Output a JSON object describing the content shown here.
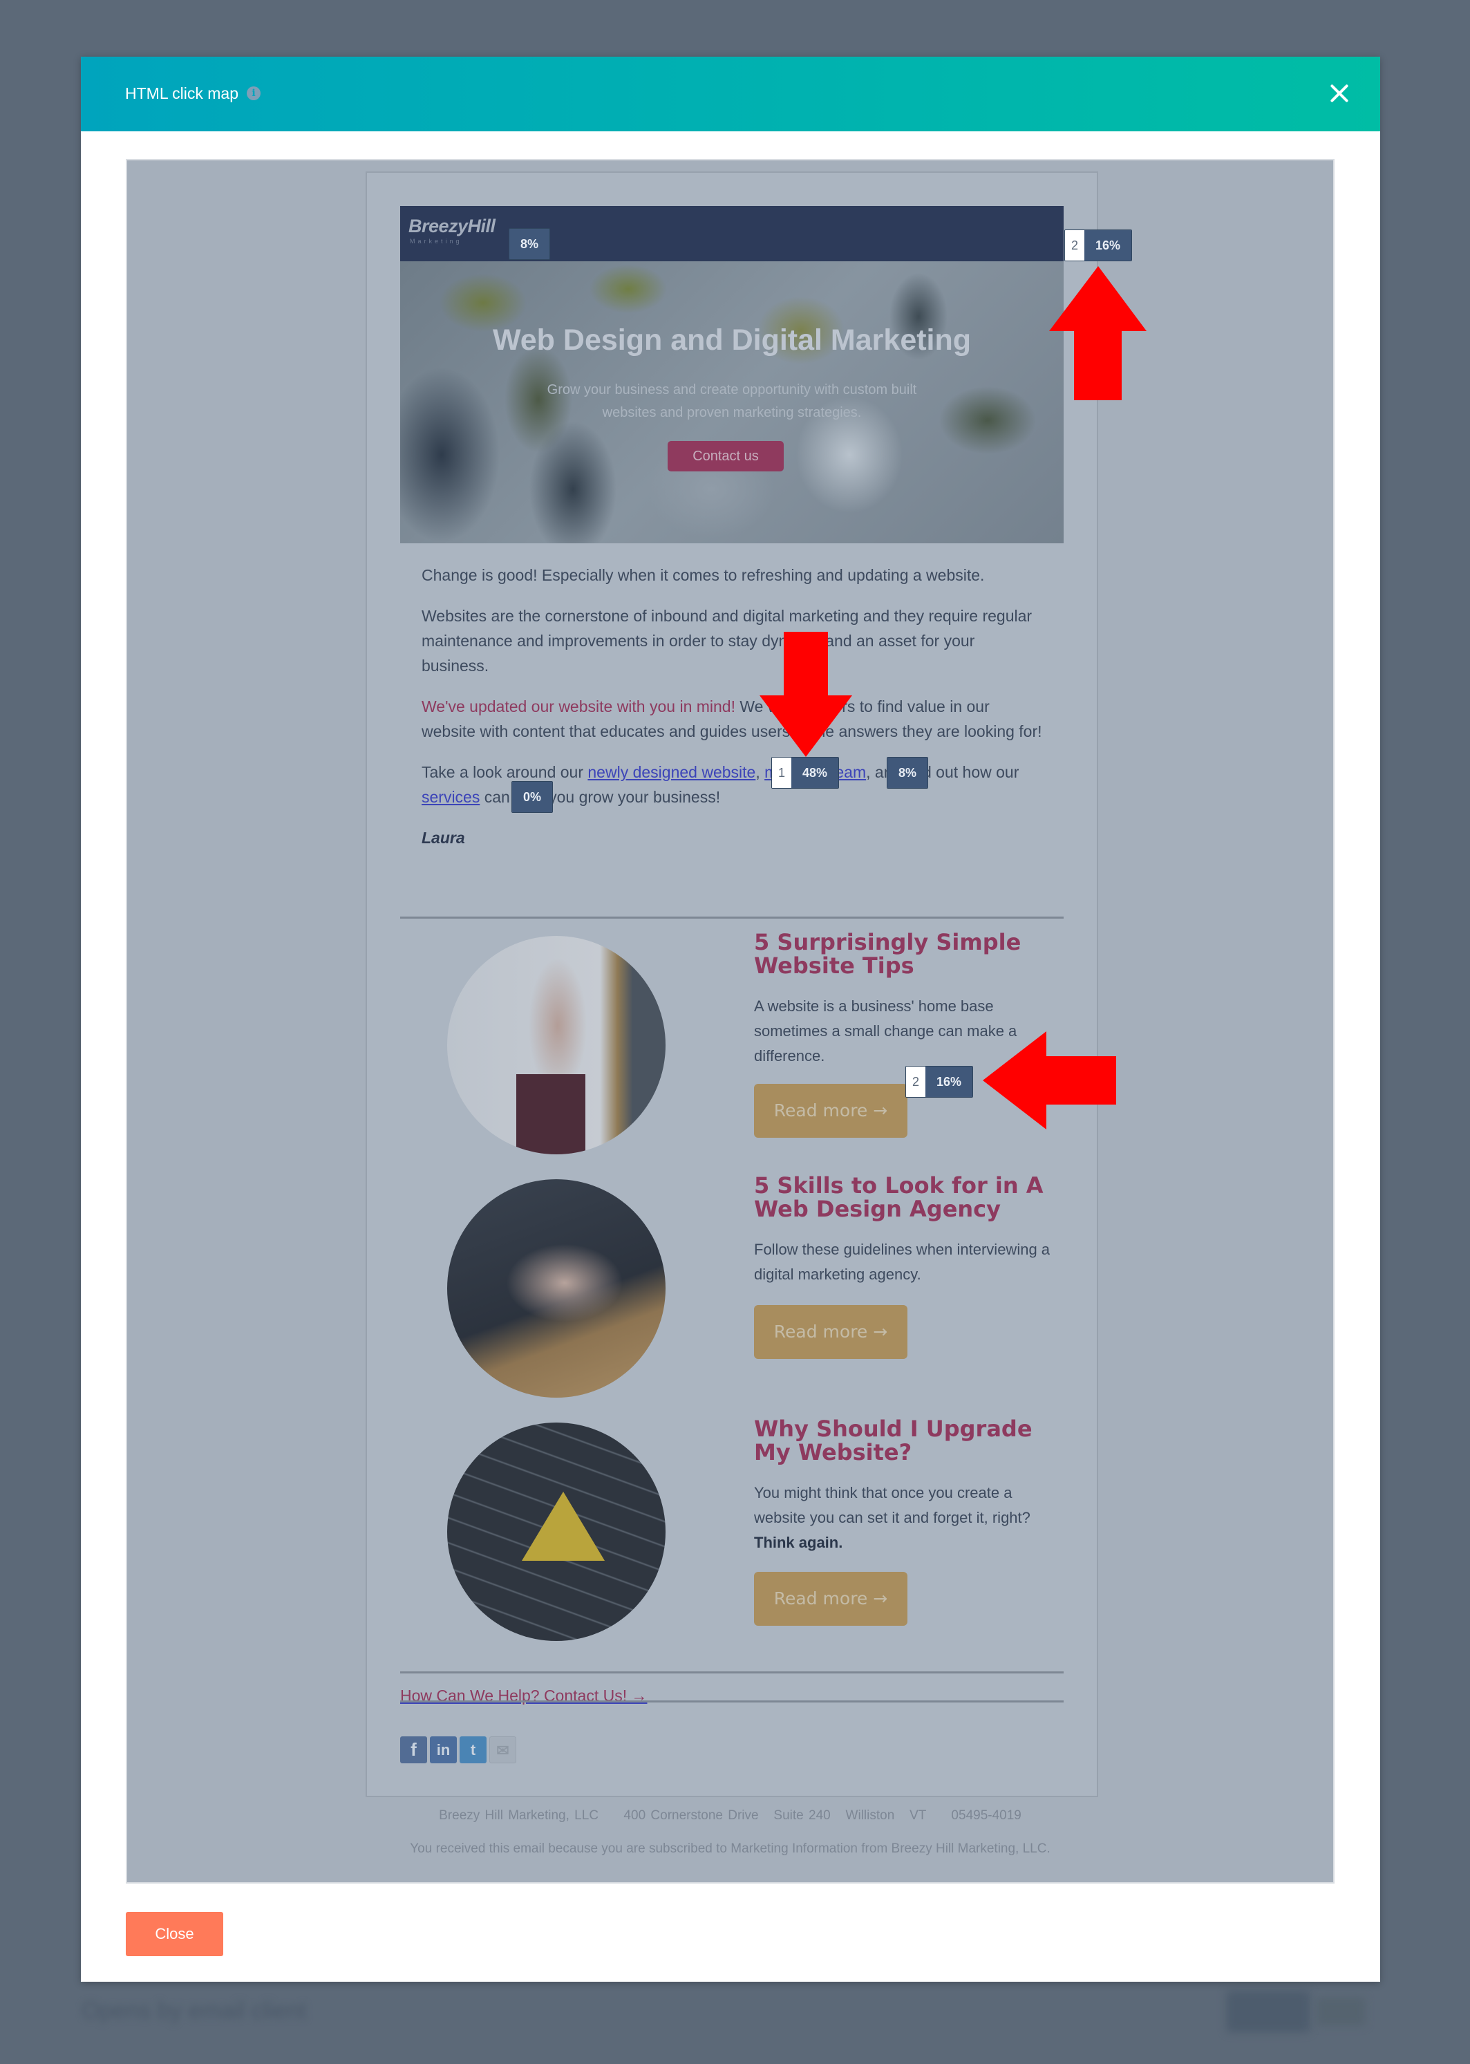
{
  "background": {
    "page_heading": "Opens by email client"
  },
  "modal": {
    "title": "HTML click map",
    "info_icon": "info-icon",
    "close_icon": "close-icon",
    "footer": {
      "close_label": "Close"
    },
    "colors": {
      "header_start": "#00a4bd",
      "header_end": "#00bda5",
      "close_button": "#ff7a59"
    }
  },
  "email": {
    "logo": {
      "name": "BreezyHill",
      "tagline": "Marketing"
    },
    "hero": {
      "title": "Web Design and Digital Marketing",
      "subtitle": "Grow your business and create opportunity with custom built websites and proven marketing strategies.",
      "button_label": "Contact us"
    },
    "body": {
      "p1": "Change is good! Especially when it comes to refreshing and updating a website.",
      "p2": "Websites are the cornerstone of inbound and digital marketing and they require regular maintenance and improvements in order to stay dynamic and an asset for your business.",
      "p3_accent": "We've updated our website with you in mind!",
      "p3_rest": " We want visitors to find value in our website with content that educates and guides users to the answers they are looking for!",
      "p4_start": "Take a look around our ",
      "p4_link1": "newly designed website",
      "p4_sep": ", ",
      "p4_link2": "meet the team",
      "p4_mid": ", and find out how our ",
      "p4_link3": "services",
      "p4_end": " can help you grow your business!",
      "signature": "Laura"
    },
    "posts": [
      {
        "title": "5 Surprisingly Simple Website Tips",
        "description": "A website is a business' home base sometimes a small change can make a difference.",
        "button_label": "Read more →",
        "image": "hand-drawing-sketch-image"
      },
      {
        "title": "5 Skills to Look for in A Web Design Agency",
        "description": "Follow these guidelines when interviewing a digital marketing agency.",
        "button_label": "Read more →",
        "image": "hands-typing-laptop-image"
      },
      {
        "title": "Why Should I Upgrade My Website?",
        "description_plain": "You might think that once you create a website you can set it and forget it, right? ",
        "description_bold": "Think again.",
        "button_label": "Read more →",
        "image": "keyboard-under-construction-image"
      }
    ],
    "cta_link": "How Can We Help? Contact Us! →",
    "social": [
      {
        "name": "facebook",
        "glyph": "f"
      },
      {
        "name": "linkedin",
        "glyph": "in"
      },
      {
        "name": "twitter",
        "glyph": "t"
      },
      {
        "name": "email",
        "glyph": "✉"
      }
    ],
    "footer_address": "Breezy Hill Marketing, LLC     400 Cornerstone Drive   Suite 240   Williston   VT     05495-4019",
    "footer_notice": "You received this email because you are subscribed to Marketing Information from Breezy Hill Marketing, LLC."
  },
  "click_badges": [
    {
      "target": "logo",
      "rank": "",
      "percent": "8%"
    },
    {
      "target": "hero-image",
      "rank": "2",
      "percent": "16%"
    },
    {
      "target": "newly-designed-website-link",
      "rank": "1",
      "percent": "48%"
    },
    {
      "target": "meet-the-team-link",
      "rank": "",
      "percent": "8%"
    },
    {
      "target": "around-link",
      "rank": "",
      "percent": "0%"
    },
    {
      "target": "read-more-post-1",
      "rank": "2",
      "percent": "16%"
    }
  ],
  "annotations": {
    "arrow_color": "#ff0000",
    "arrows": [
      "arrow-up-to-hero-badge",
      "arrow-down-to-top-link-badge",
      "arrow-left-to-read-more-badge"
    ]
  }
}
